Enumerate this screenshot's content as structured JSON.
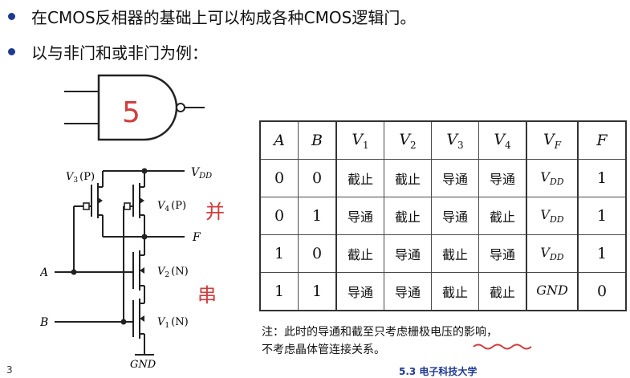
{
  "bullets": [
    {
      "text": "在CMOS反相器的基础上可以构成各种CMOS逻辑门。"
    },
    {
      "text": "以与非门和或非门为例："
    }
  ],
  "gate_annotation": "5",
  "circuit": {
    "vdd": "V",
    "vdd_sub": "DD",
    "out": "F",
    "in_a": "A",
    "in_b": "B",
    "gnd": "GND",
    "t1": {
      "v": "V",
      "n": "1",
      "type": "(N)"
    },
    "t2": {
      "v": "V",
      "n": "2",
      "type": "(N)"
    },
    "t3": {
      "v": "V",
      "n": "3",
      "type": "(P)"
    },
    "t4": {
      "v": "V",
      "n": "4",
      "type": "(P)"
    },
    "note_parallel": "并",
    "note_series": "串"
  },
  "table": {
    "headers": {
      "a": "A",
      "b": "B",
      "v1": "V",
      "v1s": "1",
      "v2": "V",
      "v2s": "2",
      "v3": "V",
      "v3s": "3",
      "v4": "V",
      "v4s": "4",
      "vf": "V",
      "vfs": "F",
      "f": "F"
    },
    "rows": [
      {
        "a": "0",
        "b": "0",
        "v1": "截止",
        "v2": "截止",
        "v3": "导通",
        "v4": "导通",
        "vf": "V",
        "vfs": "DD",
        "f": "1"
      },
      {
        "a": "0",
        "b": "1",
        "v1": "导通",
        "v2": "截止",
        "v3": "导通",
        "v4": "截止",
        "vf": "V",
        "vfs": "DD",
        "f": "1"
      },
      {
        "a": "1",
        "b": "0",
        "v1": "截止",
        "v2": "导通",
        "v3": "截止",
        "v4": "导通",
        "vf": "V",
        "vfs": "DD",
        "f": "1"
      },
      {
        "a": "1",
        "b": "1",
        "v1": "导通",
        "v2": "导通",
        "v3": "截止",
        "v4": "截止",
        "vf": "GND",
        "vfs": "",
        "f": "0"
      }
    ]
  },
  "note": {
    "line1": "注：此时的导通和截至只考虑栅极电压的影响，",
    "line2": "不考虑晶体管连接关系。"
  },
  "footer": {
    "page": "3",
    "text": "5.3 电子科技大学"
  }
}
